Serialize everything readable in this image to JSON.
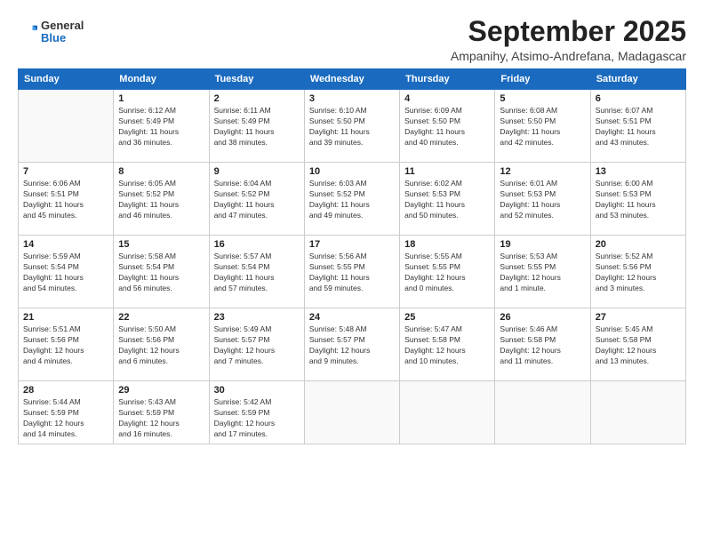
{
  "header": {
    "logo_general": "General",
    "logo_blue": "Blue",
    "month": "September 2025",
    "location": "Ampanihy, Atsimo-Andrefana, Madagascar"
  },
  "weekdays": [
    "Sunday",
    "Monday",
    "Tuesday",
    "Wednesday",
    "Thursday",
    "Friday",
    "Saturday"
  ],
  "weeks": [
    [
      {
        "day": "",
        "info": ""
      },
      {
        "day": "1",
        "info": "Sunrise: 6:12 AM\nSunset: 5:49 PM\nDaylight: 11 hours\nand 36 minutes."
      },
      {
        "day": "2",
        "info": "Sunrise: 6:11 AM\nSunset: 5:49 PM\nDaylight: 11 hours\nand 38 minutes."
      },
      {
        "day": "3",
        "info": "Sunrise: 6:10 AM\nSunset: 5:50 PM\nDaylight: 11 hours\nand 39 minutes."
      },
      {
        "day": "4",
        "info": "Sunrise: 6:09 AM\nSunset: 5:50 PM\nDaylight: 11 hours\nand 40 minutes."
      },
      {
        "day": "5",
        "info": "Sunrise: 6:08 AM\nSunset: 5:50 PM\nDaylight: 11 hours\nand 42 minutes."
      },
      {
        "day": "6",
        "info": "Sunrise: 6:07 AM\nSunset: 5:51 PM\nDaylight: 11 hours\nand 43 minutes."
      }
    ],
    [
      {
        "day": "7",
        "info": "Sunrise: 6:06 AM\nSunset: 5:51 PM\nDaylight: 11 hours\nand 45 minutes."
      },
      {
        "day": "8",
        "info": "Sunrise: 6:05 AM\nSunset: 5:52 PM\nDaylight: 11 hours\nand 46 minutes."
      },
      {
        "day": "9",
        "info": "Sunrise: 6:04 AM\nSunset: 5:52 PM\nDaylight: 11 hours\nand 47 minutes."
      },
      {
        "day": "10",
        "info": "Sunrise: 6:03 AM\nSunset: 5:52 PM\nDaylight: 11 hours\nand 49 minutes."
      },
      {
        "day": "11",
        "info": "Sunrise: 6:02 AM\nSunset: 5:53 PM\nDaylight: 11 hours\nand 50 minutes."
      },
      {
        "day": "12",
        "info": "Sunrise: 6:01 AM\nSunset: 5:53 PM\nDaylight: 11 hours\nand 52 minutes."
      },
      {
        "day": "13",
        "info": "Sunrise: 6:00 AM\nSunset: 5:53 PM\nDaylight: 11 hours\nand 53 minutes."
      }
    ],
    [
      {
        "day": "14",
        "info": "Sunrise: 5:59 AM\nSunset: 5:54 PM\nDaylight: 11 hours\nand 54 minutes."
      },
      {
        "day": "15",
        "info": "Sunrise: 5:58 AM\nSunset: 5:54 PM\nDaylight: 11 hours\nand 56 minutes."
      },
      {
        "day": "16",
        "info": "Sunrise: 5:57 AM\nSunset: 5:54 PM\nDaylight: 11 hours\nand 57 minutes."
      },
      {
        "day": "17",
        "info": "Sunrise: 5:56 AM\nSunset: 5:55 PM\nDaylight: 11 hours\nand 59 minutes."
      },
      {
        "day": "18",
        "info": "Sunrise: 5:55 AM\nSunset: 5:55 PM\nDaylight: 12 hours\nand 0 minutes."
      },
      {
        "day": "19",
        "info": "Sunrise: 5:53 AM\nSunset: 5:55 PM\nDaylight: 12 hours\nand 1 minute."
      },
      {
        "day": "20",
        "info": "Sunrise: 5:52 AM\nSunset: 5:56 PM\nDaylight: 12 hours\nand 3 minutes."
      }
    ],
    [
      {
        "day": "21",
        "info": "Sunrise: 5:51 AM\nSunset: 5:56 PM\nDaylight: 12 hours\nand 4 minutes."
      },
      {
        "day": "22",
        "info": "Sunrise: 5:50 AM\nSunset: 5:56 PM\nDaylight: 12 hours\nand 6 minutes."
      },
      {
        "day": "23",
        "info": "Sunrise: 5:49 AM\nSunset: 5:57 PM\nDaylight: 12 hours\nand 7 minutes."
      },
      {
        "day": "24",
        "info": "Sunrise: 5:48 AM\nSunset: 5:57 PM\nDaylight: 12 hours\nand 9 minutes."
      },
      {
        "day": "25",
        "info": "Sunrise: 5:47 AM\nSunset: 5:58 PM\nDaylight: 12 hours\nand 10 minutes."
      },
      {
        "day": "26",
        "info": "Sunrise: 5:46 AM\nSunset: 5:58 PM\nDaylight: 12 hours\nand 11 minutes."
      },
      {
        "day": "27",
        "info": "Sunrise: 5:45 AM\nSunset: 5:58 PM\nDaylight: 12 hours\nand 13 minutes."
      }
    ],
    [
      {
        "day": "28",
        "info": "Sunrise: 5:44 AM\nSunset: 5:59 PM\nDaylight: 12 hours\nand 14 minutes."
      },
      {
        "day": "29",
        "info": "Sunrise: 5:43 AM\nSunset: 5:59 PM\nDaylight: 12 hours\nand 16 minutes."
      },
      {
        "day": "30",
        "info": "Sunrise: 5:42 AM\nSunset: 5:59 PM\nDaylight: 12 hours\nand 17 minutes."
      },
      {
        "day": "",
        "info": ""
      },
      {
        "day": "",
        "info": ""
      },
      {
        "day": "",
        "info": ""
      },
      {
        "day": "",
        "info": ""
      }
    ]
  ]
}
